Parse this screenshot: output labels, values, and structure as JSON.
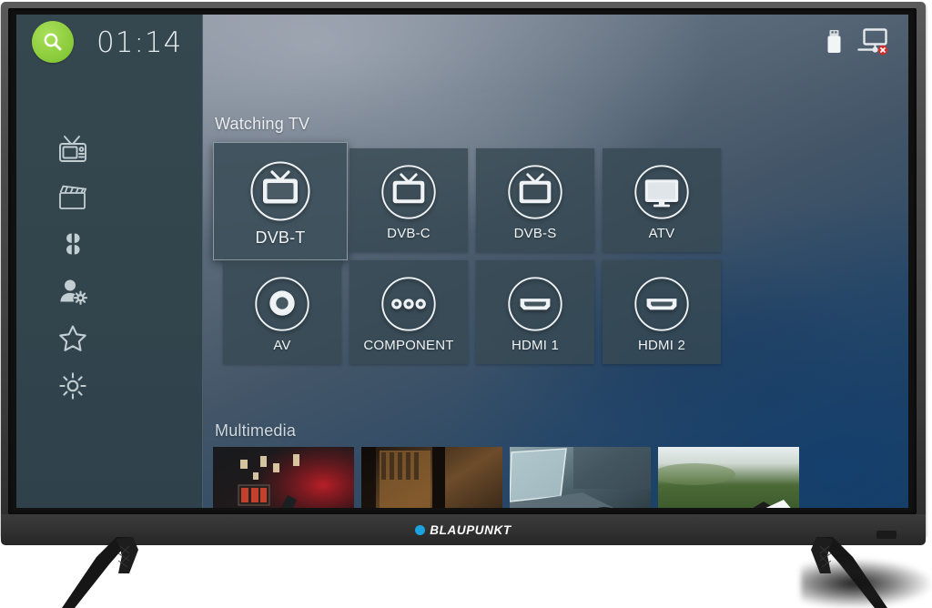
{
  "device": {
    "brand": "BLAUPUNKT",
    "brand_dot_color": "#1ba3e0"
  },
  "statusbar": {
    "clock": "01:14",
    "search_icon": "search-icon",
    "search_button_color": "#8fcf3f",
    "icons": [
      {
        "name": "usb-drive-icon",
        "label": "USB"
      },
      {
        "name": "network-disconnected-icon",
        "label": "Network disconnected"
      }
    ]
  },
  "sidebar": {
    "items": [
      {
        "icon": "tv-retro-icon",
        "label": "Live TV"
      },
      {
        "icon": "clapperboard-icon",
        "label": "Movies"
      },
      {
        "icon": "apps-grid-icon",
        "label": "Apps"
      },
      {
        "icon": "user-settings-icon",
        "label": "Account"
      },
      {
        "icon": "star-icon",
        "label": "Favourites"
      },
      {
        "icon": "gear-icon",
        "label": "Settings"
      }
    ]
  },
  "main": {
    "watching_tv": {
      "title": "Watching TV",
      "tiles": [
        {
          "label": "DVB-T",
          "icon": "tv-antenna-icon",
          "selected": true
        },
        {
          "label": "DVB-C",
          "icon": "tv-antenna-icon",
          "selected": false
        },
        {
          "label": "DVB-S",
          "icon": "tv-antenna-icon",
          "selected": false
        },
        {
          "label": "ATV",
          "icon": "monitor-icon",
          "selected": false
        },
        {
          "label": "AV",
          "icon": "rca-jack-icon",
          "selected": false
        },
        {
          "label": "COMPONENT",
          "icon": "three-jacks-icon",
          "selected": false
        },
        {
          "label": "HDMI 1",
          "icon": "hdmi-port-icon",
          "selected": false
        },
        {
          "label": "HDMI 2",
          "icon": "hdmi-port-icon",
          "selected": false
        }
      ]
    },
    "multimedia": {
      "title": "Multimedia",
      "thumbnails": [
        {
          "name": "thumbnail-1",
          "description": "Dark industrial scene with red light"
        },
        {
          "name": "thumbnail-2",
          "description": "Warm brown interior with shelves"
        },
        {
          "name": "thumbnail-3",
          "description": "Blue-grey laptop close-up"
        },
        {
          "name": "thumbnail-4",
          "description": "Green field with scattered papers"
        }
      ]
    }
  }
}
